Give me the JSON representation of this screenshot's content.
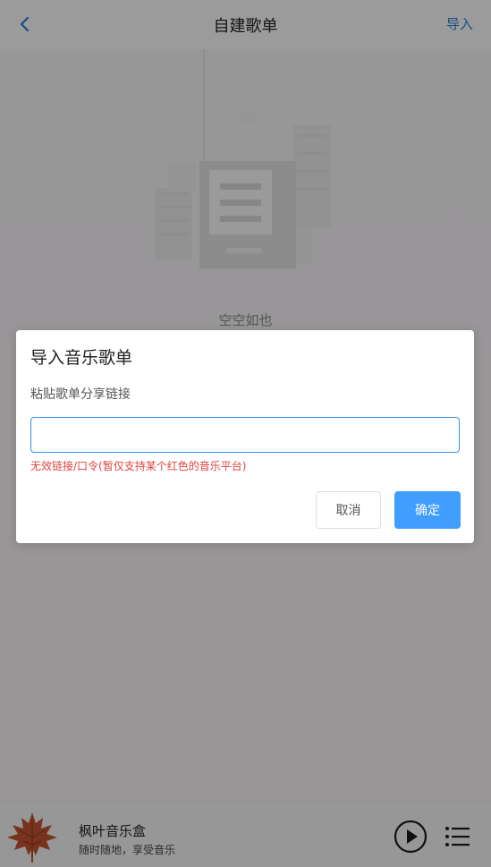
{
  "header": {
    "title": "自建歌单",
    "import_label": "导入",
    "back_icon": "chevron-left-icon"
  },
  "content": {
    "empty_text": "空空如也",
    "empty_icon": "empty-document-illustration"
  },
  "player": {
    "title": "枫叶音乐盒",
    "subtitle": "随时随地，享受音乐",
    "cover_icon": "maple-leaf-icon",
    "play_icon": "play-circle-icon",
    "list_icon": "playlist-icon"
  },
  "dialog": {
    "title": "导入音乐歌单",
    "label": "粘贴歌单分享链接",
    "input_value": "",
    "error": "无效链接/口令(暂仅支持某个红色的音乐平台)",
    "cancel_label": "取消",
    "confirm_label": "确定"
  },
  "colors": {
    "accent": "#409eff",
    "link": "#2a7fd6",
    "error": "#e0433f",
    "maple": "#c0532f"
  }
}
